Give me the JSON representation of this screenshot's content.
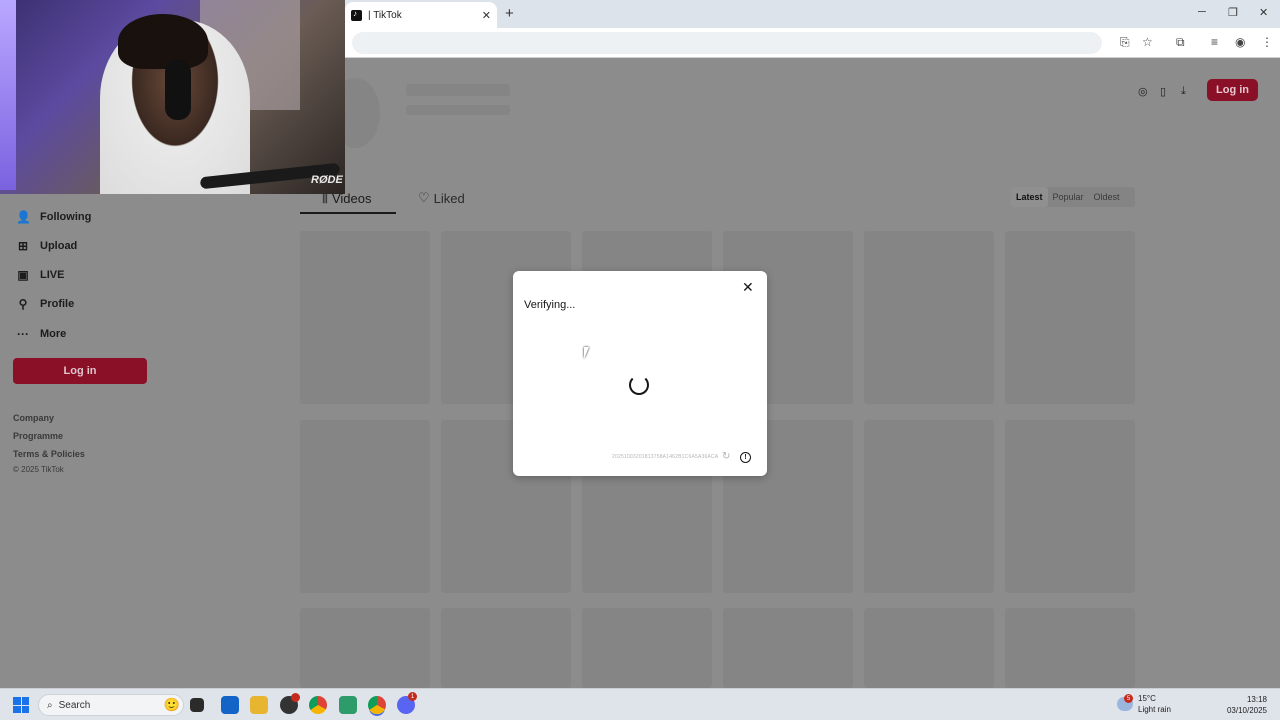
{
  "browser": {
    "tab_title": "| TikTok",
    "new_tab": "+",
    "tab_close": "✕",
    "window_controls": {
      "minimize": "─",
      "maximize": "❐",
      "close": "✕"
    }
  },
  "header": {
    "login_label": "Log in"
  },
  "content_tabs": {
    "videos_label": "Videos",
    "liked_label": "Liked",
    "sort": {
      "latest": "Latest",
      "popular": "Popular",
      "oldest": "Oldest",
      "selected": "Latest"
    }
  },
  "sidebar": {
    "items": [
      {
        "label": "Following",
        "icon": "following-icon"
      },
      {
        "label": "Upload",
        "icon": "upload-icon"
      },
      {
        "label": "LIVE",
        "icon": "live-icon"
      },
      {
        "label": "Profile",
        "icon": "profile-icon"
      },
      {
        "label": "More",
        "icon": "more-icon"
      }
    ],
    "login_label": "Log in",
    "footer_links": [
      "Company",
      "Programme",
      "Terms & Policies"
    ],
    "copyright": "© 2025 TikTok"
  },
  "webcam": {
    "brand": "RØDE"
  },
  "modal": {
    "title": "Verifying...",
    "close": "✕",
    "code": "20251003201813758A1462B1C6A5A36ACA",
    "info": "!"
  },
  "taskbar": {
    "search_placeholder": "Search",
    "weather_temp": "15°C",
    "weather_desc": "Light rain",
    "weather_badge": "5",
    "time": "13:18",
    "date": "03/10/2025",
    "discord_badge": "1"
  }
}
